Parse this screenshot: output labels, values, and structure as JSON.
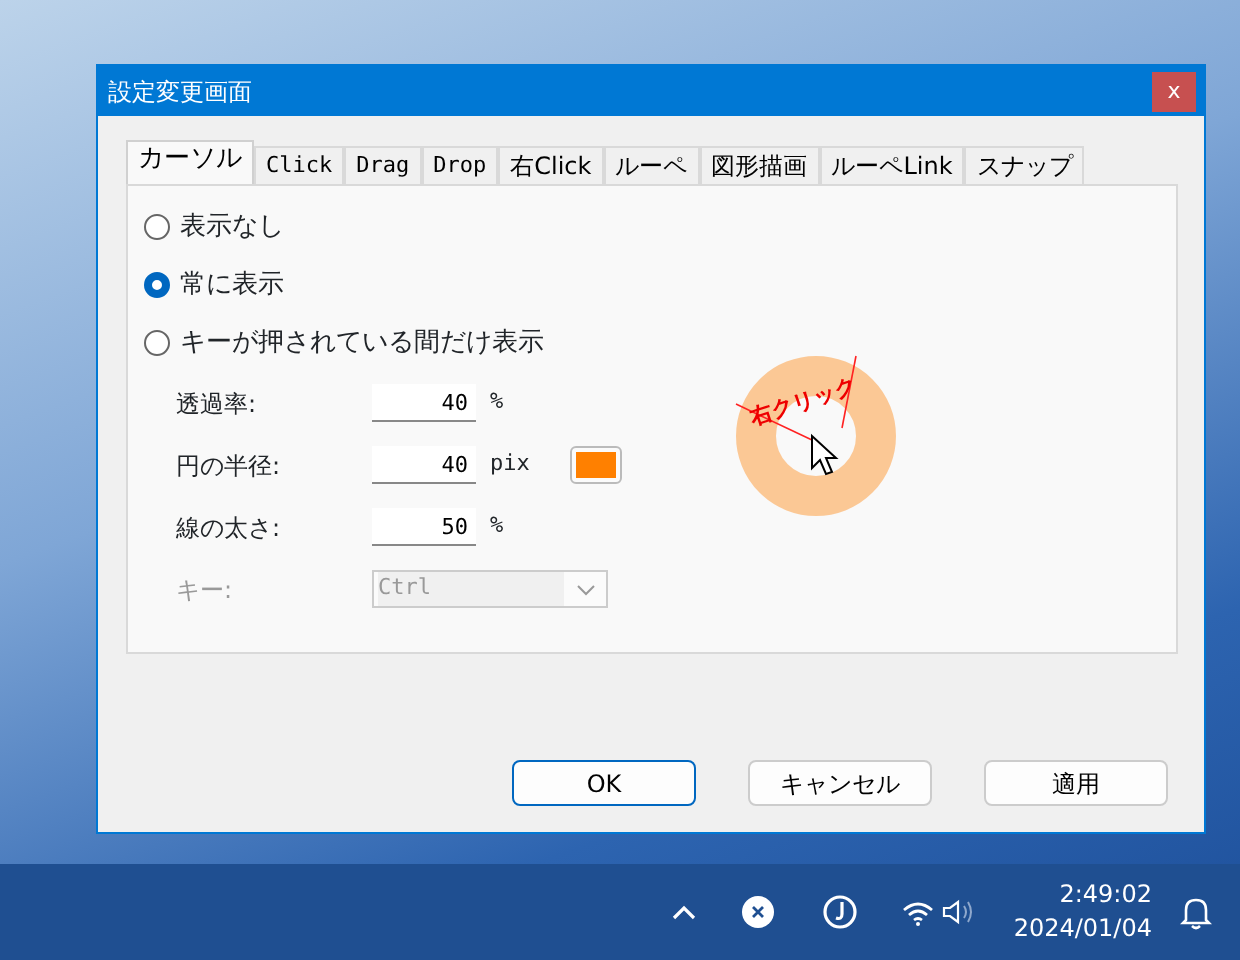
{
  "window": {
    "title": "設定変更画面",
    "close": "x"
  },
  "tabs": [
    {
      "label": "カーソル",
      "selected": true
    },
    {
      "label": "Click",
      "selected": false
    },
    {
      "label": "Drag",
      "selected": false
    },
    {
      "label": "Drop",
      "selected": false
    },
    {
      "label": "右Click",
      "selected": false
    },
    {
      "label": "ルーペ",
      "selected": false
    },
    {
      "label": "図形描画",
      "selected": false
    },
    {
      "label": "ルーペLink",
      "selected": false
    },
    {
      "label": "スナップ",
      "selected": false
    }
  ],
  "display_options": [
    {
      "label": "表示なし",
      "selected": false
    },
    {
      "label": "常に表示",
      "selected": true
    },
    {
      "label": "キーが押されている間だけ表示",
      "selected": false
    }
  ],
  "settings": [
    {
      "kind": "number",
      "label": "透過率:",
      "value": "40",
      "unit": "%"
    },
    {
      "kind": "number",
      "label": "円の半径:",
      "value": "40",
      "unit": "pix",
      "color": "#ff8000"
    },
    {
      "kind": "number",
      "label": "線の太さ:",
      "value": "50",
      "unit": "%"
    },
    {
      "kind": "select",
      "label": "キー:",
      "value": "Ctrl",
      "disabled": true
    }
  ],
  "preview": {
    "label": "右クリック"
  },
  "buttons": [
    {
      "label": "OK",
      "default": true
    },
    {
      "label": "キャンセル",
      "default": false
    },
    {
      "label": "適用",
      "default": false
    }
  ],
  "taskbar": {
    "time": "2:49:02",
    "date": "2024/01/04"
  }
}
